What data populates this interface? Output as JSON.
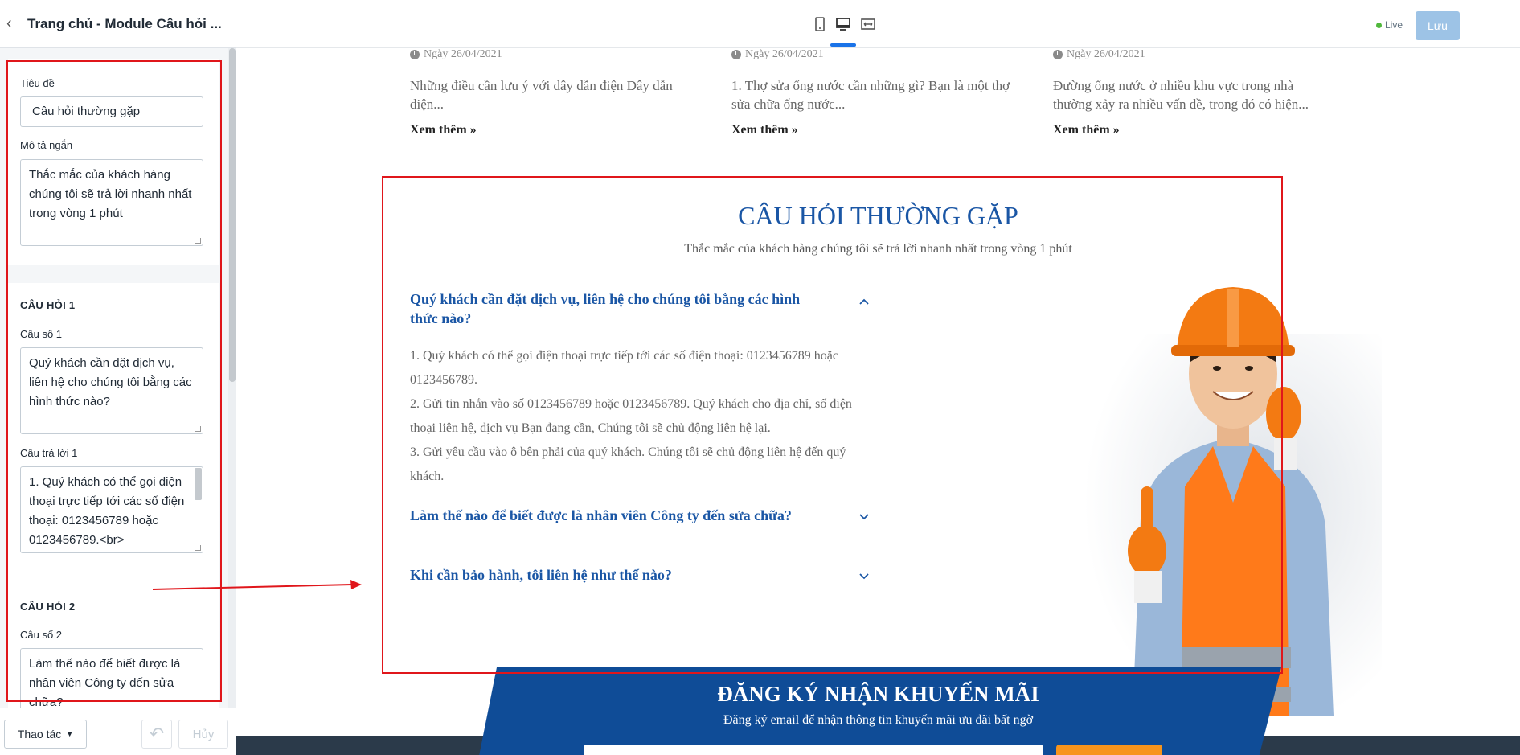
{
  "panel": {
    "title": "Trang chủ - Module Câu hỏi ...",
    "fields": {
      "title_label": "Tiêu đề",
      "title_value": "Câu hỏi thường gặp",
      "desc_label": "Mô tả ngắn",
      "desc_value": "Thắc mắc của khách hàng chúng tôi sẽ trả lời nhanh nhất trong vòng 1 phút"
    },
    "q1": {
      "heading": "CÂU HỎI 1",
      "question_label": "Câu số 1",
      "question_value": "Quý khách cần đặt dịch vụ, liên hệ cho chúng tôi bằng các hình thức nào?",
      "answer_label": "Câu trả lời 1",
      "answer_value": "1. Quý khách có thể gọi điện thoại trực tiếp tới các số điện thoại: 0123456789 hoặc 0123456789.<br>"
    },
    "q2": {
      "heading": "CÂU HỎI 2",
      "question_label": "Câu số 2",
      "question_value": "Làm thế nào để biết được là nhân viên Công ty đến sửa chữa?"
    },
    "footer": {
      "actions_label": "Thao tác",
      "cancel_label": "Hủy"
    }
  },
  "topbar": {
    "live_label": "Live",
    "save_label": "Lưu",
    "device_icons": [
      "mobile-icon",
      "desktop-icon",
      "fullwidth-icon"
    ]
  },
  "news": [
    {
      "date": "Ngày 26/04/2021",
      "excerpt": "Những điều cần lưu ý với dây dẫn điện Dây dẫn điện...",
      "more": "Xem thêm »"
    },
    {
      "date": "Ngày 26/04/2021",
      "excerpt": "1. Thợ sửa ống nước cần những gì? Bạn là một thợ sửa chữa ống nước...",
      "more": "Xem thêm »"
    },
    {
      "date": "Ngày 26/04/2021",
      "excerpt": "Đường ống nước ở nhiều khu vực trong nhà thường xảy ra nhiều vấn đề, trong đó có hiện...",
      "more": "Xem thêm »"
    }
  ],
  "faq": {
    "title": "CÂU HỎI THƯỜNG GẶP",
    "subtitle": "Thắc mắc của khách hàng chúng tôi sẽ trả lời nhanh nhất trong vòng 1 phút",
    "items": [
      {
        "question": "Quý khách cần đặt dịch vụ, liên hệ cho chúng tôi bằng các hình thức nào?",
        "expanded": true
      },
      {
        "question": "Làm thế nào để biết được là nhân viên Công ty đến sửa chữa?",
        "expanded": false
      },
      {
        "question": "Khi cần bảo hành, tôi liên hệ như thế nào?",
        "expanded": false
      }
    ],
    "answer_lines": [
      "1. Quý khách có thể gọi điện thoại trực tiếp tới các số điện thoại: 0123456789 hoặc 0123456789.",
      "2. Gửi tin nhắn vào số 0123456789 hoặc 0123456789. Quý khách cho địa chỉ, số điện thoại liên hệ, dịch vụ Bạn đang cần, Chúng tôi sẽ chủ động liên hệ lại.",
      "3. Gửi yêu cầu vào ô bên phải của quý khách. Chúng tôi sẽ chủ động liên hệ đến quý khách."
    ]
  },
  "promo": {
    "title": "ĐĂNG KÝ NHẬN KHUYẾN MÃI",
    "subtitle": "Đăng ký email để nhận thông tin khuyến mãi ưu đãi bất ngờ",
    "brand_blue": "#0f4c97",
    "accent_orange": "#f7941d"
  },
  "colors": {
    "annotation_red": "#e0161b",
    "heading_blue": "#1a56a5"
  }
}
